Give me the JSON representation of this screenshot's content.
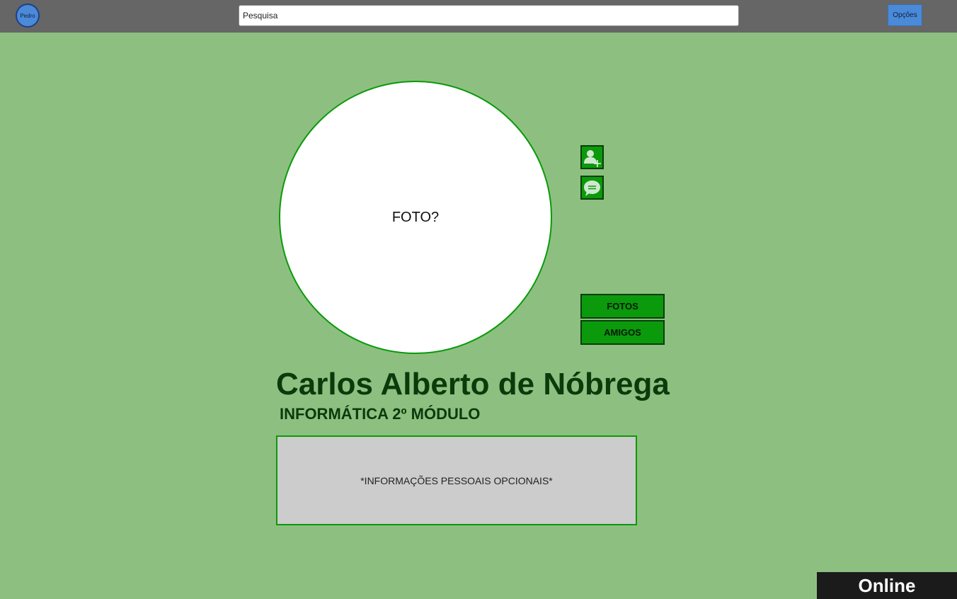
{
  "header": {
    "user_name": "Pedro",
    "search_placeholder": "Pesquisa",
    "options_label": "Opções"
  },
  "profile": {
    "photo_placeholder": "FOTO?",
    "name": "Carlos Alberto de Nóbrega",
    "course": "INFORMÁTICA 2º MÓDULO",
    "info_text": "*INFORMAÇÕES PESSOAIS OPCIONAIS*"
  },
  "actions": {
    "add_friend_icon": "add-user-icon",
    "message_icon": "chat-bubble-icon"
  },
  "menu": {
    "photos_label": "FOTOS",
    "friends_label": "AMIGOS"
  },
  "status": {
    "label": "Online"
  },
  "colors": {
    "background": "#8dc080",
    "topbar": "#666666",
    "accent_green": "#0b9a0b",
    "accent_blue": "#4a8ad8",
    "dark_green_text": "#0b3a0b"
  }
}
